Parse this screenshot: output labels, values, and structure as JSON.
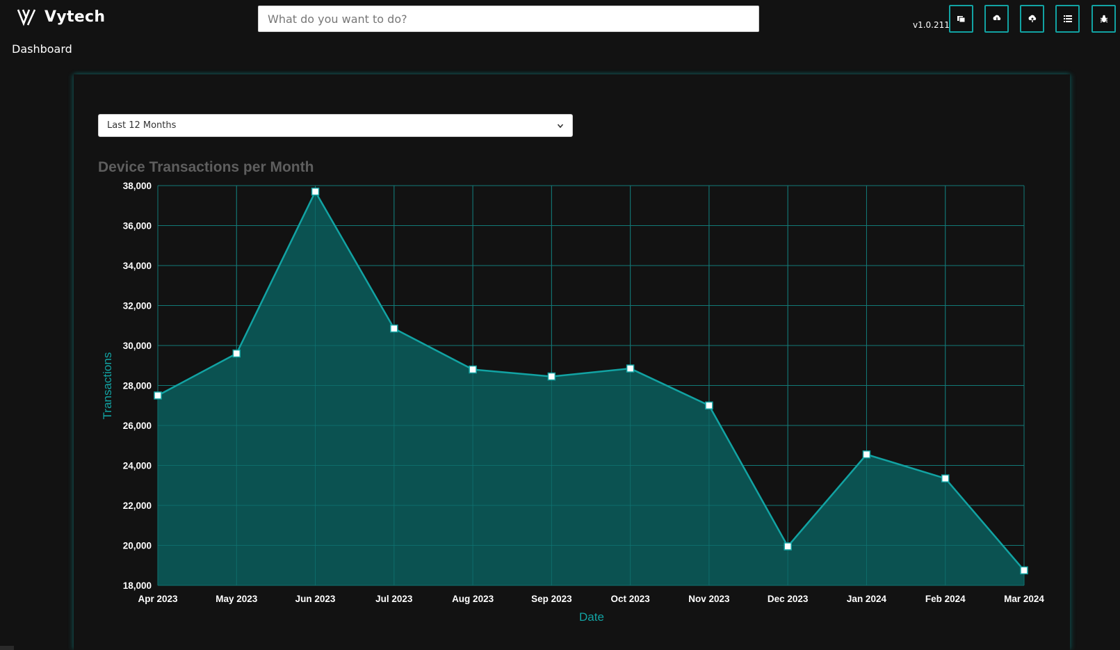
{
  "app": {
    "name": "Vytech",
    "version": "v1.0.211"
  },
  "search": {
    "placeholder": "What do you want to do?"
  },
  "toolbar": {
    "icons": [
      "windows-icon",
      "cloud-download-icon",
      "cloud-upload-icon",
      "list-icon",
      "bug-icon"
    ]
  },
  "breadcrumb": {
    "label": "Dashboard"
  },
  "filter": {
    "selected": "Last 12 Months"
  },
  "colors": {
    "accent": "#12a3a3",
    "area_fill": "#0b5857",
    "grid": "#137a78",
    "title": "#5e5e5e"
  },
  "chart_data": {
    "type": "area",
    "title": "Device Transactions per Month",
    "xlabel": "Date",
    "ylabel": "Transactions",
    "categories": [
      "Apr 2023",
      "May 2023",
      "Jun 2023",
      "Jul 2023",
      "Aug 2023",
      "Sep 2023",
      "Oct 2023",
      "Nov 2023",
      "Dec 2023",
      "Jan 2024",
      "Feb 2024",
      "Mar 2024"
    ],
    "series": [
      {
        "values": [
          27500,
          29600,
          37700,
          30850,
          28800,
          28450,
          28850,
          27000,
          19950,
          24550,
          23350,
          18750
        ]
      }
    ],
    "ylim": [
      18000,
      38000
    ],
    "yticks": [
      "18,000",
      "20,000",
      "22,000",
      "24,000",
      "26,000",
      "28,000",
      "30,000",
      "32,000",
      "34,000",
      "36,000",
      "38,000"
    ],
    "grid": true,
    "legend": "none"
  }
}
